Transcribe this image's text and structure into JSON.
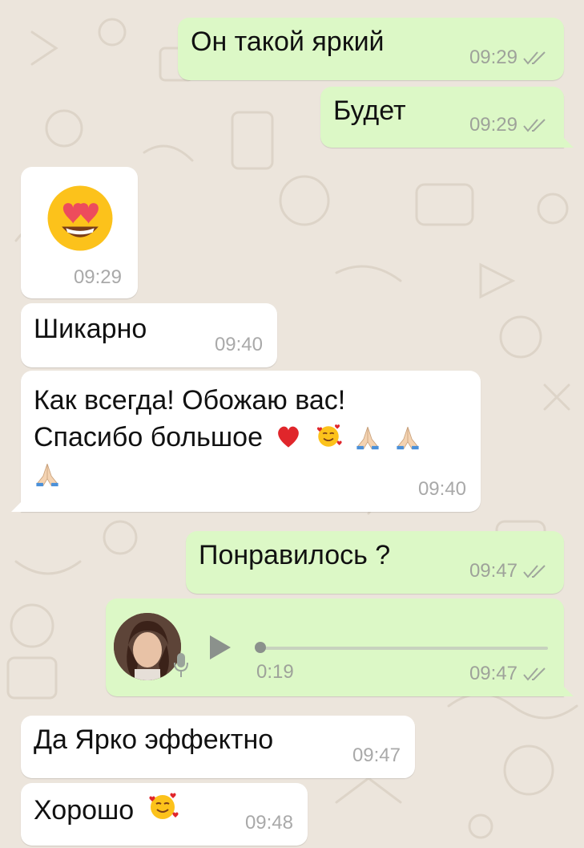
{
  "chat": {
    "messages": [
      {
        "id": "m1",
        "direction": "outgoing",
        "text": "Он такой яркий",
        "time": "09:29",
        "status": "read"
      },
      {
        "id": "m2",
        "direction": "outgoing",
        "text": "Будет",
        "time": "09:29",
        "status": "read"
      },
      {
        "id": "m3",
        "direction": "incoming",
        "emoji": "heart-eyes-face",
        "time": "09:29"
      },
      {
        "id": "m4",
        "direction": "incoming",
        "text": "Шикарно",
        "time": "09:40"
      },
      {
        "id": "m5",
        "direction": "incoming",
        "line1": "Как всегда! Обожаю вас!",
        "line2": "Спасибо большое",
        "emojis": [
          "red-heart",
          "smiling-face-with-hearts",
          "folded-hands",
          "folded-hands",
          "folded-hands"
        ],
        "time": "09:40"
      },
      {
        "id": "m6",
        "direction": "outgoing",
        "text": "Понравилось ?",
        "time": "09:47",
        "status": "read"
      },
      {
        "id": "m7",
        "direction": "outgoing",
        "type": "voice",
        "duration": "0:19",
        "progress": 0,
        "time": "09:47",
        "status": "read"
      },
      {
        "id": "m8",
        "direction": "incoming",
        "text": "Да Ярко эффектно",
        "time": "09:47"
      },
      {
        "id": "m9",
        "direction": "incoming",
        "text": "Хорошо",
        "emoji": "smiling-face-with-hearts",
        "time": "09:48"
      }
    ]
  },
  "colors": {
    "outgoing_bubble": "#dcf8c6",
    "incoming_bubble": "#ffffff",
    "background": "#ece5dc",
    "read_ticks": "#9fa59c"
  }
}
